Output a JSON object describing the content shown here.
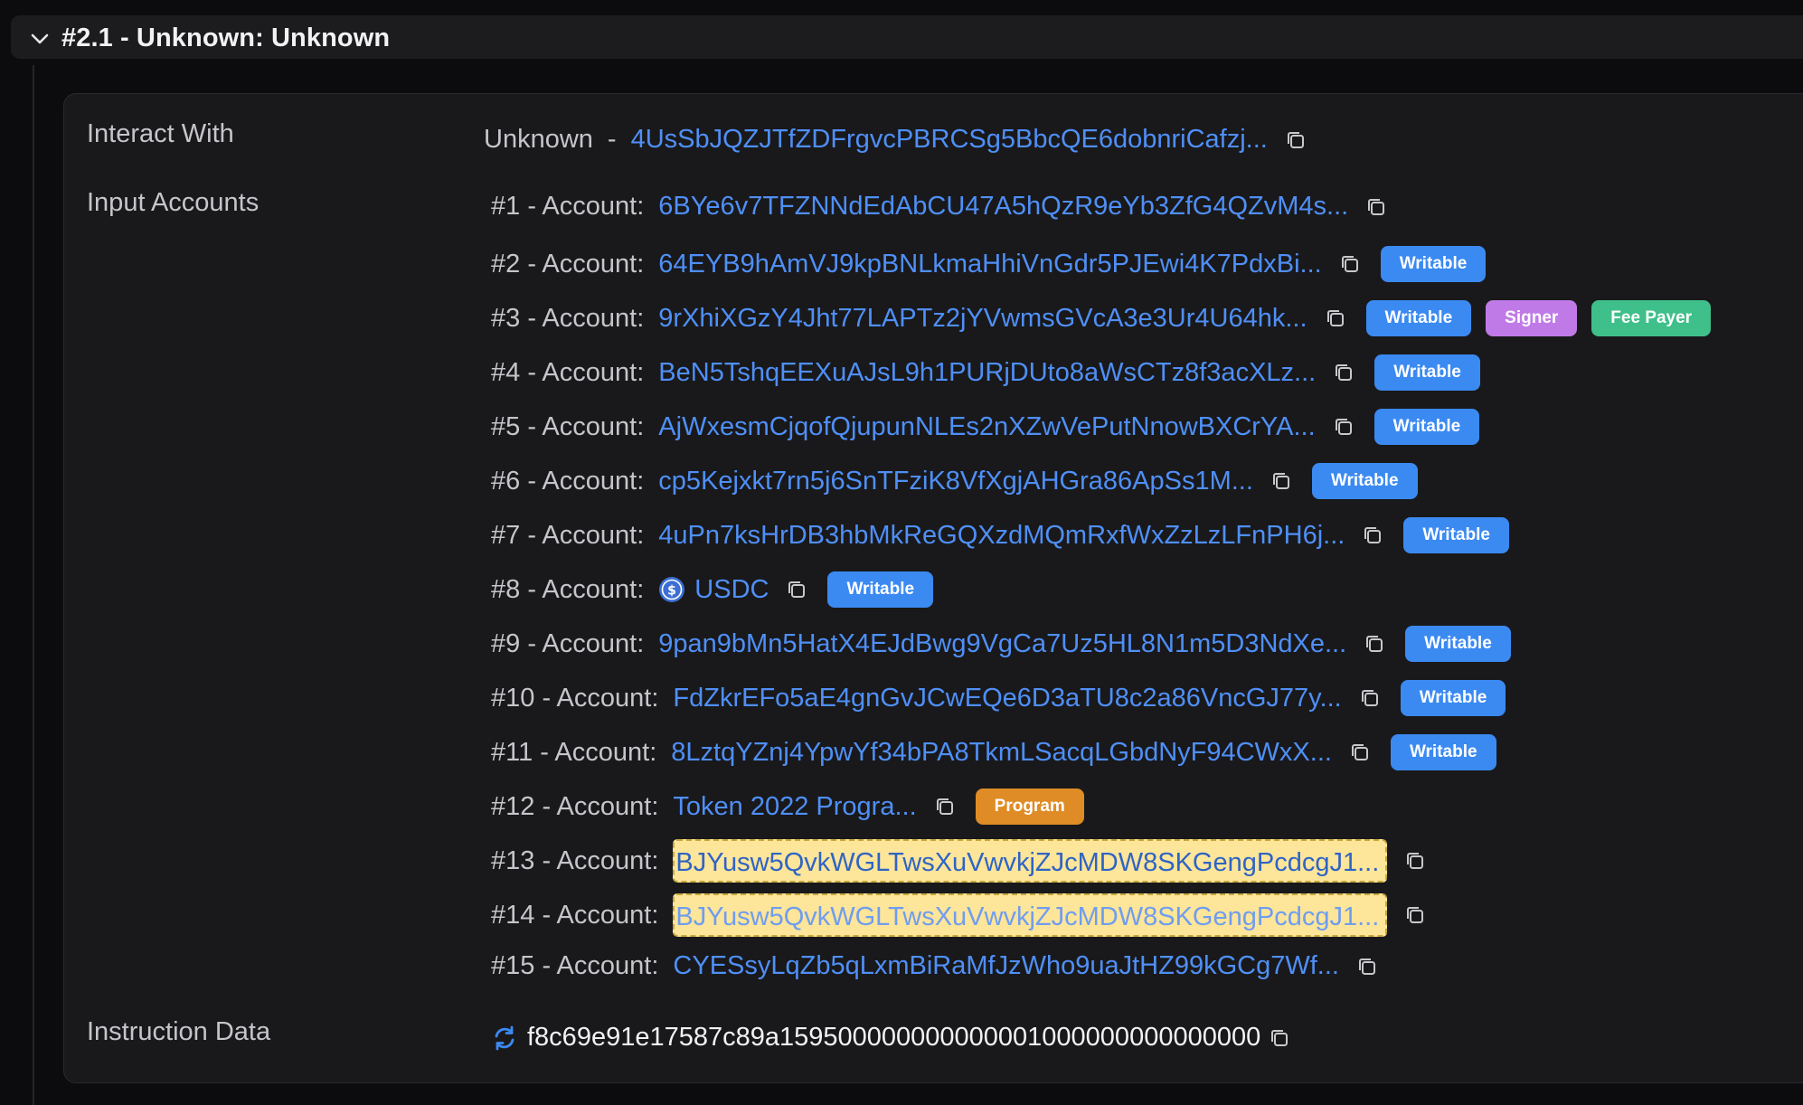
{
  "section": {
    "title": "#2.1 - Unknown: Unknown"
  },
  "labels": {
    "interact_with": "Interact With",
    "input_accounts": "Input Accounts",
    "instruction_data": "Instruction Data"
  },
  "interact": {
    "program_name": "Unknown",
    "separator": "-",
    "address": "4UsSbJQZJTfZDFrgvcPBRCSg5BbcQE6dobnriCafzj..."
  },
  "accounts": [
    {
      "prefix": "#1 - Account:",
      "address": "6BYe6v7TFZNNdEdAbCU47A5hQzR9eYb3ZfG4QZvM4s...",
      "badges": []
    },
    {
      "prefix": "#2 - Account:",
      "address": "64EYB9hAmVJ9kpBNLkmaHhiVnGdr5PJEwi4K7PdxBi...",
      "badges": [
        "Writable"
      ]
    },
    {
      "prefix": "#3 - Account:",
      "address": "9rXhiXGzY4Jht77LAPTz2jYVwmsGVcA3e3Ur4U64hk...",
      "badges": [
        "Writable",
        "Signer",
        "Fee Payer"
      ]
    },
    {
      "prefix": "#4 - Account:",
      "address": "BeN5TshqEEXuAJsL9h1PURjDUto8aWsCTz8f3acXLz...",
      "badges": [
        "Writable"
      ]
    },
    {
      "prefix": "#5 - Account:",
      "address": "AjWxesmCjqofQjupunNLEs2nXZwVePutNnowBXCrYA...",
      "badges": [
        "Writable"
      ]
    },
    {
      "prefix": "#6 - Account:",
      "address": "cp5Kejxkt7rn5j6SnTFziK8VfXgjAHGra86ApSs1M...",
      "badges": [
        "Writable"
      ]
    },
    {
      "prefix": "#7 - Account:",
      "address": "4uPn7ksHrDB3hbMkReGQXzdMQmRxfWxZzLzLFnPH6j...",
      "badges": [
        "Writable"
      ]
    },
    {
      "prefix": "#8 - Account:",
      "address": "USDC",
      "badges": [
        "Writable"
      ]
    },
    {
      "prefix": "#9 - Account:",
      "address": "9pan9bMn5HatX4EJdBwg9VgCa7Uz5HL8N1m5D3NdXe...",
      "badges": [
        "Writable"
      ]
    },
    {
      "prefix": "#10 - Account:",
      "address": "FdZkrEFo5aE4gnGvJCwEQe6D3aTU8c2a86VncGJ77y...",
      "badges": [
        "Writable"
      ]
    },
    {
      "prefix": "#11 - Account:",
      "address": "8LztqYZnj4YpwYf34bPA8TkmLSacqLGbdNyF94CWxX...",
      "badges": [
        "Writable"
      ]
    },
    {
      "prefix": "#12 - Account:",
      "address": "Token 2022 Progra...",
      "badges": [
        "Program"
      ]
    },
    {
      "prefix": "#13 - Account:",
      "address": "BJYusw5QvkWGLTwsXuVwvkjZJcMDW8SKGengPcdcgJ1...",
      "badges": []
    },
    {
      "prefix": "#14 - Account:",
      "address": "BJYusw5QvkWGLTwsXuVwvkjZJcMDW8SKGengPcdcgJ1...",
      "badges": []
    },
    {
      "prefix": "#15 - Account:",
      "address": "CYESsyLqZb5qLxmBiRaMfJzWho9uaJtHZ99kGCg7Wf...",
      "badges": []
    }
  ],
  "instruction_data": {
    "hex": "f8c69e91e17587c89a159500000000000001000000000000000"
  },
  "colors": {
    "link": "#4f8ff7",
    "writable": "#3b8af2",
    "signer": "#c07ae8",
    "fee_payer": "#3fbf8a",
    "program": "#df8c26",
    "highlight": "#fde59a"
  },
  "icons": {
    "expand": "chevron-down-icon",
    "copy": "copy-icon",
    "token": "usdc-icon",
    "data_format": "refresh-icon"
  }
}
